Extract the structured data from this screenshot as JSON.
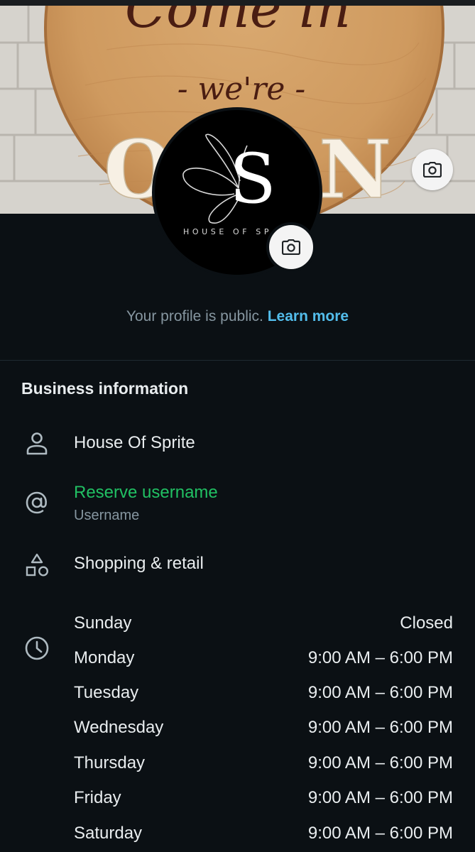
{
  "cover": {
    "sign_text": {
      "line1": "Come in",
      "line2": "- we're -",
      "line3_left": "O",
      "line3_right": "N"
    }
  },
  "avatar": {
    "initial": "S",
    "brand_text": "HOUSE OF SP"
  },
  "public_note": {
    "text": "Your profile is public.",
    "link": "Learn more"
  },
  "business_info": {
    "title": "Business information",
    "name": "House Of Sprite",
    "username_action": "Reserve username",
    "username_label": "Username",
    "category": "Shopping & retail",
    "hours": [
      {
        "day": "Sunday",
        "time": "Closed"
      },
      {
        "day": "Monday",
        "time": "9:00 AM – 6:00 PM"
      },
      {
        "day": "Tuesday",
        "time": "9:00 AM – 6:00 PM"
      },
      {
        "day": "Wednesday",
        "time": "9:00 AM – 6:00 PM"
      },
      {
        "day": "Thursday",
        "time": "9:00 AM – 6:00 PM"
      },
      {
        "day": "Friday",
        "time": "9:00 AM – 6:00 PM"
      },
      {
        "day": "Saturday",
        "time": "9:00 AM – 6:00 PM"
      }
    ]
  },
  "icons": {
    "cover_camera": "camera-icon",
    "avatar_camera": "camera-icon",
    "name": "person-icon",
    "username": "at-sign-icon",
    "category": "shapes-icon",
    "hours": "clock-icon"
  },
  "colors": {
    "background": "#0b1014",
    "link": "#53bdeb",
    "accent_green": "#21c063",
    "secondary_text": "#8696a0"
  }
}
